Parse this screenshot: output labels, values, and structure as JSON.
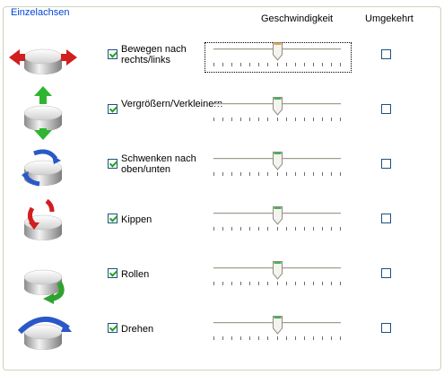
{
  "group": {
    "title": "Einzelachsen"
  },
  "headers": {
    "speed": "Geschwindigkeit",
    "reverse": "Umgekehrt"
  },
  "axes": [
    {
      "label": "Bewegen nach rechts/links",
      "enabled": true,
      "speed": 0.5,
      "reversed": false,
      "focused": true,
      "thumb_color": "#e8a53a",
      "icon": "move-right-left-icon"
    },
    {
      "label": "Vergrößern/Verkleinern",
      "enabled": true,
      "speed": 0.5,
      "reversed": false,
      "focused": false,
      "thumb_color": "#3fb54a",
      "icon": "zoom-icon"
    },
    {
      "label": "Schwenken nach oben/unten",
      "enabled": true,
      "speed": 0.5,
      "reversed": false,
      "focused": false,
      "thumb_color": "#3fb54a",
      "icon": "tilt-forward-icon"
    },
    {
      "label": "Kippen",
      "enabled": true,
      "speed": 0.5,
      "reversed": false,
      "focused": false,
      "thumb_color": "#3fb54a",
      "icon": "tilt-icon"
    },
    {
      "label": "Rollen",
      "enabled": true,
      "speed": 0.5,
      "reversed": false,
      "focused": false,
      "thumb_color": "#3fb54a",
      "icon": "roll-icon"
    },
    {
      "label": "Drehen",
      "enabled": true,
      "speed": 0.5,
      "reversed": false,
      "focused": false,
      "thumb_color": "#3fb54a",
      "icon": "spin-icon"
    }
  ],
  "colors": {
    "group_title": "#0046d5",
    "check": "#21a121"
  }
}
